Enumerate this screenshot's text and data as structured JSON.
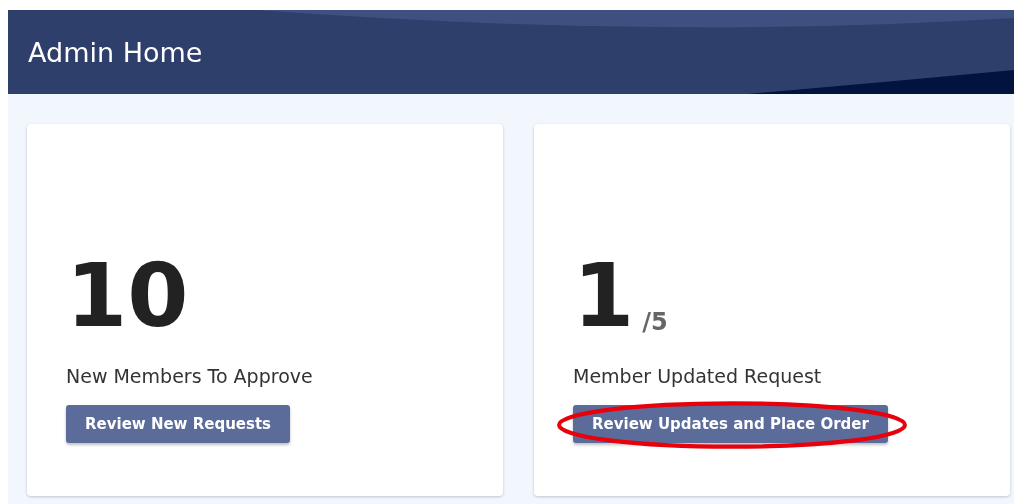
{
  "header": {
    "title": "Admin Home"
  },
  "cards": [
    {
      "count": "10",
      "label": "New Members To Approve",
      "button": "Review New Requests",
      "highlighted": false
    },
    {
      "count": "1",
      "total": "/5",
      "label": "Member Updated Request",
      "button": "Review Updates and Place Order",
      "highlighted": true
    }
  ]
}
